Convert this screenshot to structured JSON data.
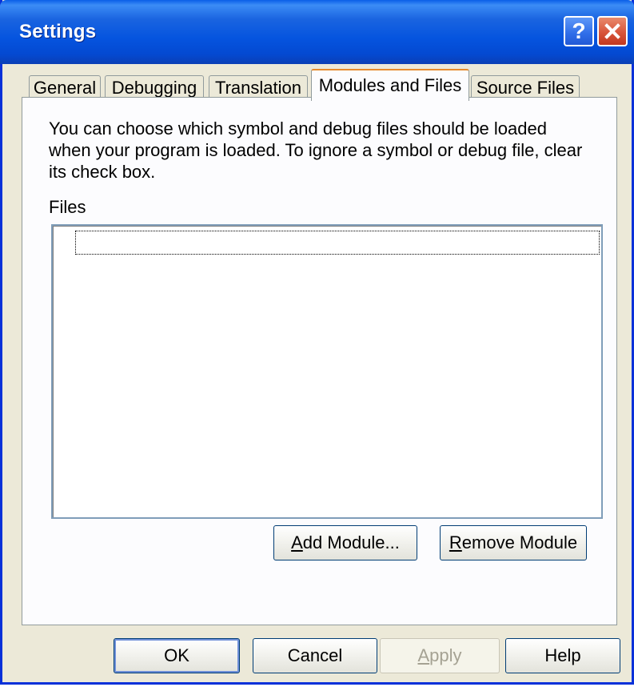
{
  "window": {
    "title": "Settings",
    "help_glyph": "?"
  },
  "tabs": [
    {
      "label": "General",
      "active": false
    },
    {
      "label": "Debugging",
      "active": false
    },
    {
      "label": "Translation",
      "active": false
    },
    {
      "label": "Modules and Files",
      "active": true
    },
    {
      "label": "Source Files",
      "active": false
    }
  ],
  "panel": {
    "description": "You can choose which symbol and debug files should be loaded when your program is loaded.  To ignore a symbol or debug file, clear its check box.",
    "files_label": "Files",
    "files": [
      ""
    ],
    "add_module": {
      "accel": "A",
      "rest": "dd Module..."
    },
    "remove_module": {
      "accel": "R",
      "rest": "emove Module"
    }
  },
  "footer": {
    "ok": "OK",
    "cancel": "Cancel",
    "apply": {
      "accel": "A",
      "rest": "pply"
    },
    "help": "Help"
  },
  "colors": {
    "titlebar": "#0554df",
    "face": "#ece9d8",
    "active_tab_accent": "#e68b2c"
  },
  "icons": [
    "help-icon",
    "close-icon"
  ]
}
